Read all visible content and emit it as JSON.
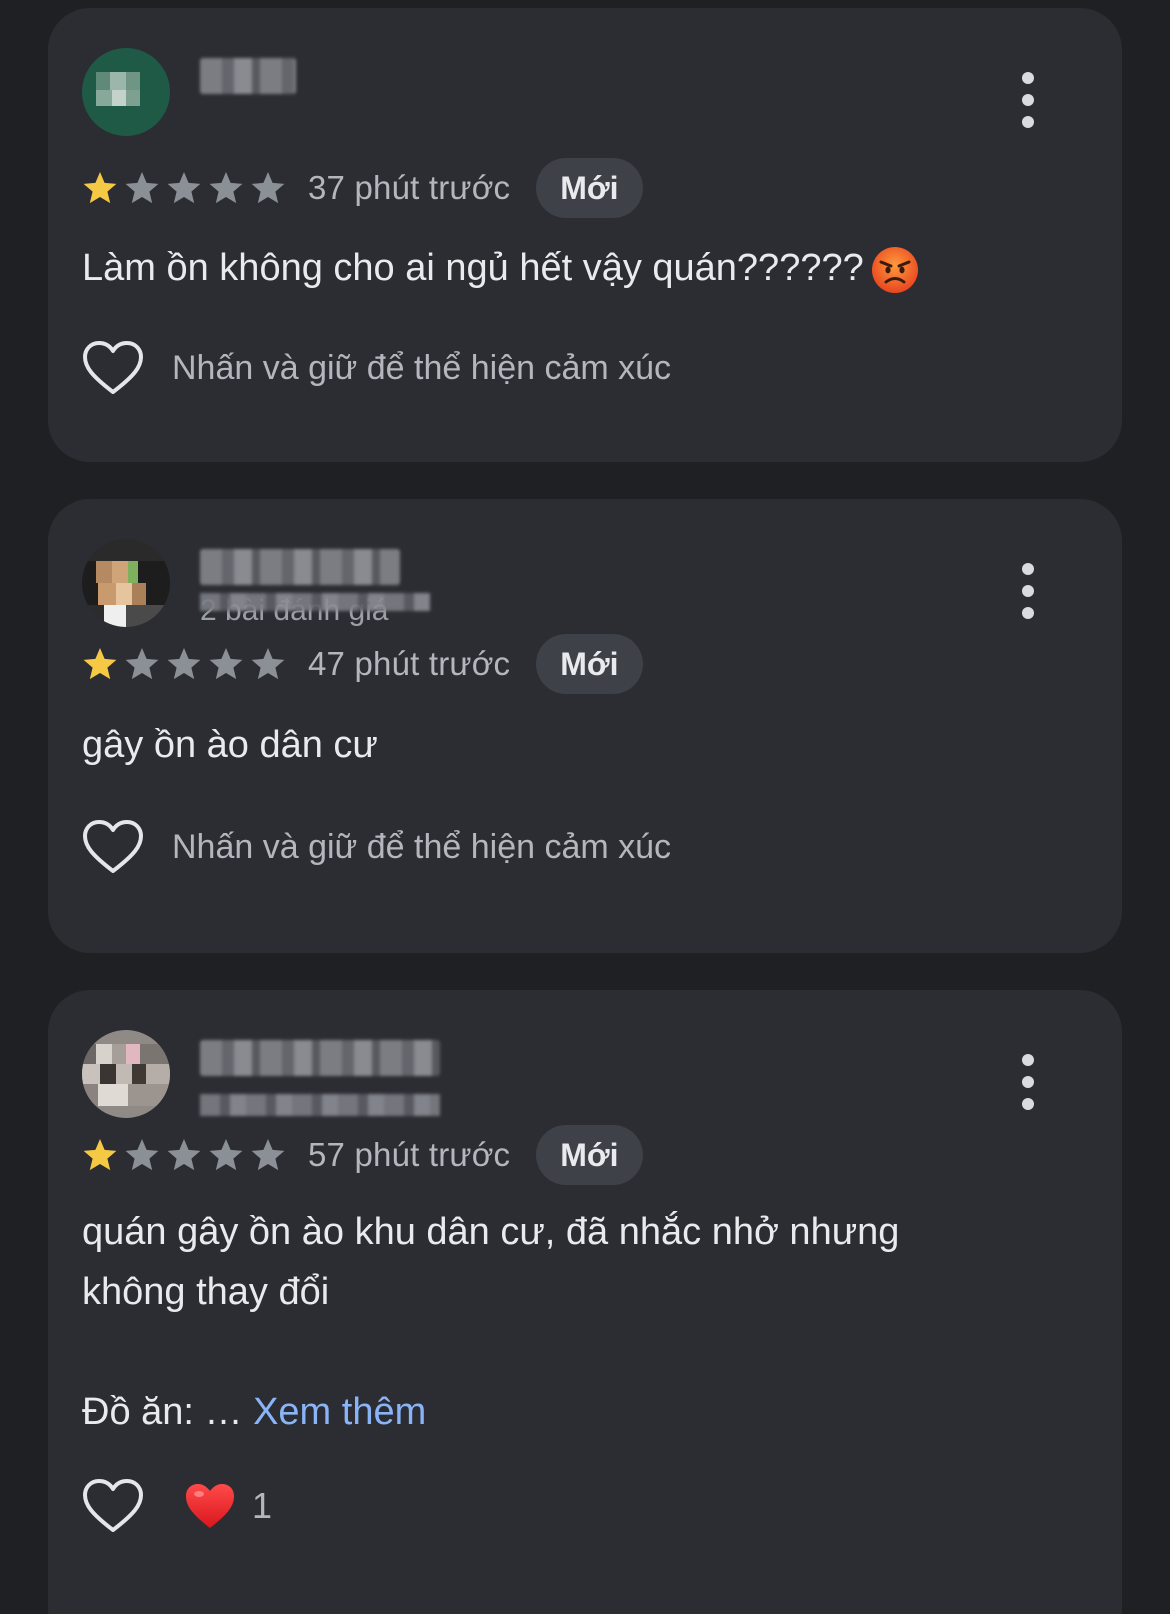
{
  "reviews": [
    {
      "avatar_color": "#1f5a47",
      "subtitle": "",
      "rating": 1,
      "max_rating": 5,
      "time": "37 phút trước",
      "badge": "Mới",
      "text": "Làm ồn không cho ai ngủ hết vậy quán??????",
      "has_angry_emoji": true,
      "react_hint": "Nhấn và giữ để thể hiện cảm xúc"
    },
    {
      "avatar_color": "#a07a52",
      "subtitle": "2 bài đánh giá",
      "rating": 1,
      "max_rating": 5,
      "time": "47 phút trước",
      "badge": "Mới",
      "text": "gây ồn ào dân cư",
      "react_hint": "Nhấn và giữ để thể hiện cảm xúc"
    },
    {
      "avatar_color": "#8f8a86",
      "subtitle": "",
      "rating": 1,
      "max_rating": 5,
      "time": "57 phút trước",
      "badge": "Mới",
      "text": "quán gây ồn ào khu dân cư, đã nhắc nhở nhưng\nkhông thay đổi\n\nĐồ ăn: … ",
      "see_more": "Xem thêm",
      "reaction_count": "1"
    }
  ],
  "colors": {
    "star_filled": "#f6c945",
    "star_empty": "#8b8f96",
    "card_bg": "#2b2d33",
    "page_bg": "#1f2024",
    "link": "#8ab4f8"
  },
  "icons": {
    "star": "star-icon",
    "more": "more-vertical-icon",
    "heart_outline": "heart-outline-icon",
    "heart_filled": "red-heart-icon",
    "angry_face": "angry-face-icon"
  }
}
